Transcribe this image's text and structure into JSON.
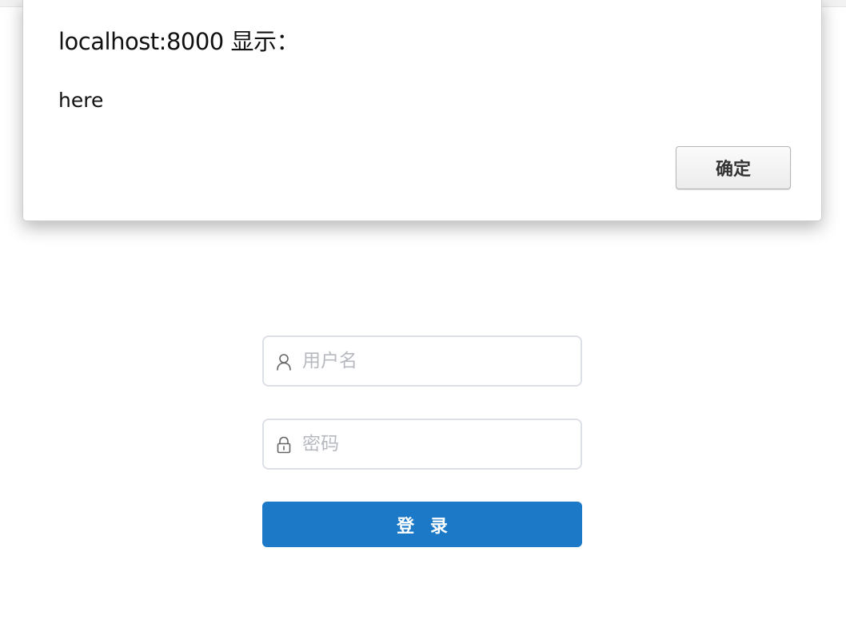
{
  "alert": {
    "title": "localhost:8000 显示：",
    "message": "here",
    "ok_label": "确定"
  },
  "login": {
    "username": {
      "placeholder": "用户名",
      "value": "",
      "icon": "user-icon"
    },
    "password": {
      "placeholder": "密码",
      "value": "",
      "icon": "lock-icon"
    },
    "submit_label": "登 录"
  },
  "colors": {
    "primary": "#1b79c8",
    "input_border": "#dcdfe6",
    "placeholder": "#b6b9bf"
  }
}
